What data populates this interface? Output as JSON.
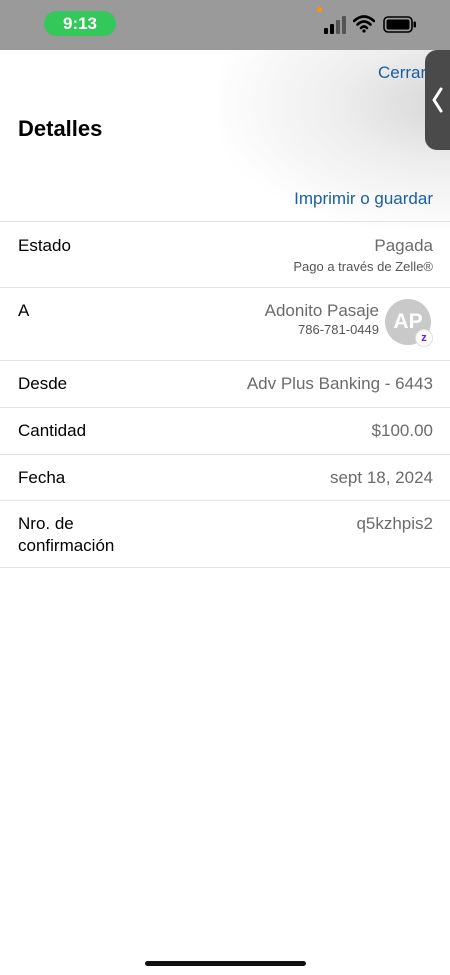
{
  "status_bar": {
    "time": "9:13"
  },
  "header": {
    "close_label": "Cerrar",
    "title": "Detalles",
    "print_label": "Imprimir o guardar"
  },
  "details": {
    "estado": {
      "label": "Estado",
      "value": "Pagada",
      "sub": "Pago a través de Zelle®"
    },
    "recipient": {
      "label": "A",
      "name": "Adonito Pasaje",
      "phone": "786-781-0449",
      "initials": "AP",
      "badge": "z"
    },
    "desde": {
      "label": "Desde",
      "value": "Adv Plus Banking - 6443"
    },
    "cantidad": {
      "label": "Cantidad",
      "value": "$100.00"
    },
    "fecha": {
      "label": "Fecha",
      "value": "sept 18, 2024"
    },
    "confirmacion": {
      "label_line1": "Nro. de",
      "label_line2": "confirmación",
      "value": "q5kzhpis2"
    }
  },
  "colors": {
    "link": "#1a5fa0",
    "time_pill": "#34c759",
    "zelle": "#6d1ed4"
  },
  "icons": [
    "signal-icon",
    "wifi-icon",
    "battery-icon",
    "chevron-left-icon",
    "zelle-icon"
  ]
}
